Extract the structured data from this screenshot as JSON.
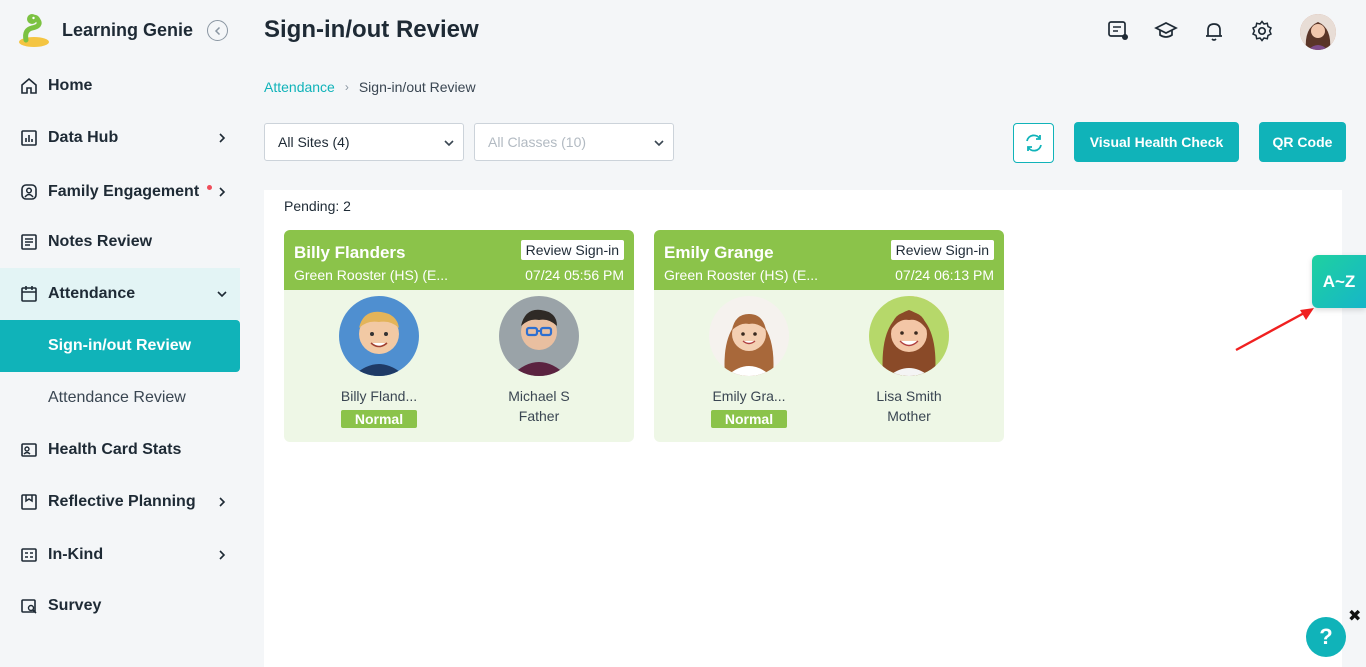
{
  "app": {
    "brand": "Learning Genie"
  },
  "sidebar": {
    "items": [
      {
        "label": "Home",
        "icon": "home-icon"
      },
      {
        "label": "Data Hub",
        "icon": "chart-icon"
      },
      {
        "label": "Family Engagement",
        "icon": "family-icon"
      },
      {
        "label": "Notes Review",
        "icon": "notes-icon"
      },
      {
        "label": "Attendance",
        "icon": "calendar-icon"
      },
      {
        "label": "Health Card Stats",
        "icon": "health-card-icon"
      },
      {
        "label": "Reflective Planning",
        "icon": "planning-icon"
      },
      {
        "label": "In-Kind",
        "icon": "inkind-icon"
      },
      {
        "label": "Survey",
        "icon": "survey-icon"
      }
    ],
    "attendance_sub": [
      {
        "label": "Sign-in/out Review",
        "active": true
      },
      {
        "label": "Attendance Review",
        "active": false
      }
    ]
  },
  "header": {
    "title": "Sign-in/out Review",
    "icons": [
      "chat-icon",
      "graduation-cap-icon",
      "bell-icon",
      "gear-icon"
    ]
  },
  "breadcrumb": {
    "parent": "Attendance",
    "current": "Sign-in/out Review"
  },
  "filters": {
    "sites": "All Sites (4)",
    "classes": "All Classes (10)"
  },
  "actions": {
    "visual_health_check": "Visual Health Check",
    "qr_code": "QR Code"
  },
  "pending_label": "Pending: 2",
  "cards": [
    {
      "name": "Billy Flanders",
      "class": "Green Rooster (HS) (E...",
      "tag": "Review Sign-in",
      "time": "07/24 05:56 PM",
      "child": {
        "name": "Billy Fland...",
        "status": "Normal"
      },
      "guardian": {
        "name": "Michael S",
        "relation": "Father"
      }
    },
    {
      "name": "Emily Grange",
      "class": "Green Rooster (HS) (E...",
      "tag": "Review Sign-in",
      "time": "07/24 06:13 PM",
      "child": {
        "name": "Emily Gra...",
        "status": "Normal"
      },
      "guardian": {
        "name": "Lisa Smith",
        "relation": "Mother"
      }
    }
  ],
  "floating": {
    "az": "A~Z",
    "help": "?",
    "close": "✖"
  },
  "colors": {
    "accent": "#10b3b9",
    "card_green": "#8bc34a",
    "card_bg": "#eef7e6"
  }
}
